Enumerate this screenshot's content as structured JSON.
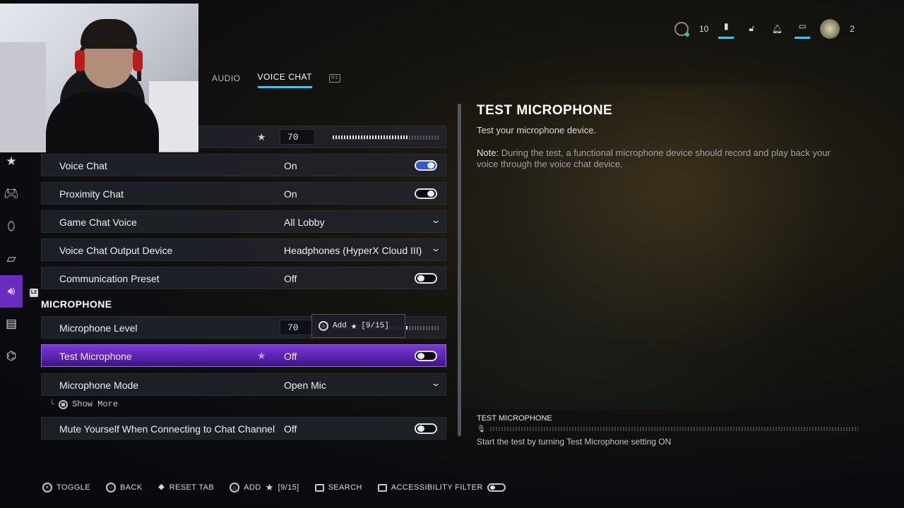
{
  "tabs": [
    {
      "label": "AUDIO"
    },
    {
      "label": "VOICE CHAT",
      "active": true
    }
  ],
  "tab_extra_icon": "r1-button-icon",
  "hud": {
    "rank": "10",
    "party_count": "2"
  },
  "top_row": {
    "value": "70",
    "fill": 0.7
  },
  "rows": {
    "voice_chat": {
      "label": "Voice Chat",
      "value": "On"
    },
    "proximity_chat": {
      "label": "Proximity Chat",
      "value": "On"
    },
    "game_chat_voice": {
      "label": "Game Chat Voice",
      "value": "All Lobby"
    },
    "output_device": {
      "label": "Voice Chat Output Device",
      "value": "Headphones (HyperX Cloud III)"
    },
    "comm_preset": {
      "label": "Communication Preset",
      "value": "Off"
    },
    "mic_level": {
      "label": "Microphone Level",
      "value": "70",
      "fill": 0.7
    },
    "test_mic": {
      "label": "Test Microphone",
      "value": "Off"
    },
    "mic_mode": {
      "label": "Microphone Mode",
      "value": "Open Mic"
    },
    "mute_yourself": {
      "label": "Mute Yourself When Connecting to Chat Channel",
      "value": "Off"
    }
  },
  "section_microphone": "MICROPHONE",
  "show_more": "Show More",
  "tooltip": {
    "add": "Add",
    "count": "[9/15]"
  },
  "detail": {
    "title": "TEST MICROPHONE",
    "desc": "Test your microphone device.",
    "note_label": "Note:",
    "note_text": " During the test, a functional microphone device should record and play back your voice through the voice chat device.",
    "meter_title": "TEST MICROPHONE",
    "meter_desc": "Start the test by turning Test Microphone setting ON"
  },
  "footer": {
    "toggle": "TOGGLE",
    "back": "BACK",
    "reset_tab": "RESET TAB",
    "add": "ADD",
    "add_count": "[9/15]",
    "search": "SEARCH",
    "accessibility": "ACCESSIBILITY FILTER"
  },
  "colors": {
    "accent_purple": "#6a2cc0",
    "tab_underline": "#3fc7e8",
    "toggle_on": "#2f5bd0"
  }
}
